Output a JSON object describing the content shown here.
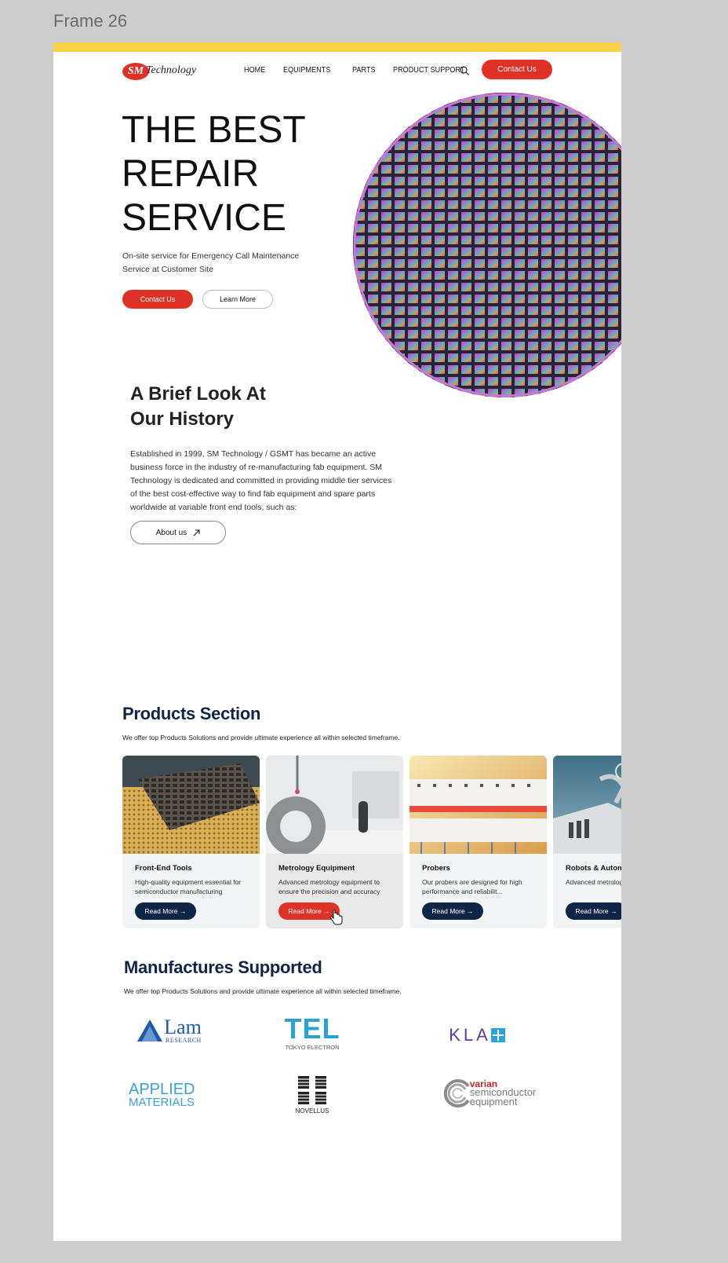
{
  "canvas": {
    "frame_label": "Frame 26"
  },
  "colors": {
    "accent_red": "#e03127",
    "navy": "#0f2547",
    "yellow_bar": "#fbd049"
  },
  "header": {
    "logo_badge": "SM",
    "logo_text": "Technology",
    "nav": [
      "HOME",
      "EQUIPMENTS",
      "PARTS",
      "PRODUCT SUPPORT"
    ],
    "search_icon": "search-icon",
    "contact_label": "Contact Us"
  },
  "hero": {
    "title_line1": "THE BEST",
    "title_line2": "REPAIR",
    "title_line3": "SERVICE",
    "subtitle": "On-site service for Emergency Call Maintenance Service at Customer Site",
    "contact_label": "Contact Us",
    "learn_label": "Learn More"
  },
  "history": {
    "title_line1": "A Brief Look At",
    "title_line2": "Our History",
    "body": "Established in 1999, SM Technology / GSMT has became an active business force in the industry of re-manufacturing fab equipment. SM Technology is dedicated and committed in providing middle tier services of the best cost-effective way to find fab equipment and spare parts worldwide at variable front end tools, such as:",
    "about_label": "About us",
    "about_icon": "arrow-up-right-icon"
  },
  "products": {
    "title": "Products Section",
    "subtitle": "We offer top Products Solutions and provide ultimate experience all within selected timeframe.",
    "cards": [
      {
        "title": "Front-End Tools",
        "desc": "High-quality equipment essential for semiconductor manufacturing",
        "btn": "Read More →"
      },
      {
        "title": "Metrology Equipment",
        "desc": "Advanced metrology equipment to ensure the precision and accuracy",
        "btn": "Read More →"
      },
      {
        "title": "Probers",
        "desc": "Our probers are designed for high performance and reliabilit...",
        "btn": "Read More →"
      },
      {
        "title": "Robots & Automa",
        "desc": "Advanced metrolog ensure the precisio",
        "btn": "Read More →"
      }
    ]
  },
  "manufacturers": {
    "title": "Manufactures Supported",
    "subtitle": "We offer top Products Solutions and provide ultimate experience all within selected timeframe.",
    "lam": {
      "word": "Lam",
      "sub": "RESEARCH"
    },
    "tel": {
      "word": "TEL",
      "sub": "TOKYO ELECTRON"
    },
    "kla": {
      "word": "KLA"
    },
    "applied": {
      "line1": "APPLIED",
      "line2": "MATERIALS"
    },
    "novellus": {
      "word": "NOVELLUS"
    },
    "varian": {
      "line1": "varian",
      "line2": "semiconductor",
      "line3": "equipment"
    }
  }
}
